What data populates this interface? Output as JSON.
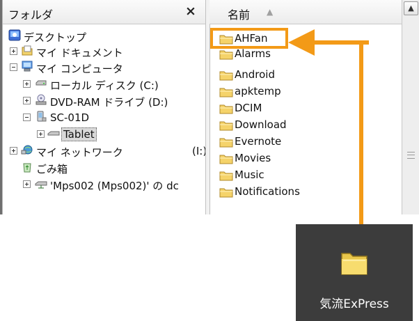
{
  "folder_pane": {
    "title": "フォルダ",
    "close_glyph": "×",
    "tree": [
      {
        "label": "デスクトップ",
        "icon": "desktop-icon"
      },
      {
        "label": "マイ ドキュメント",
        "icon": "my-documents-icon"
      },
      {
        "label": "マイ コンピュータ",
        "icon": "my-computer-icon"
      },
      {
        "label": "ローカル ディスク (C:)",
        "icon": "local-disk-icon"
      },
      {
        "label": "DVD-RAM ドライブ (D:)",
        "icon": "dvd-drive-icon"
      },
      {
        "label": "SC-01D",
        "icon": "phone-icon"
      },
      {
        "label": "Tablet",
        "icon": "tablet-drive-icon"
      },
      {
        "label": "マイ ネットワーク",
        "icon": "network-icon",
        "suffix": "(I:)"
      },
      {
        "label": "ごみ箱",
        "icon": "recycle-bin-icon"
      },
      {
        "label": "'Mps002 (Mps002)' の dc",
        "icon": "network-share-icon"
      }
    ]
  },
  "list_pane": {
    "column_name": "名前",
    "sort_glyph": "▲",
    "files": [
      "AHFan",
      "Alarms",
      "Android",
      "apktemp",
      "DCIM",
      "Download",
      "Evernote",
      "Movies",
      "Music",
      "Notifications"
    ]
  },
  "desktop_shortcut": {
    "label": "気流ExPress"
  },
  "colors": {
    "accent": "#f39a17",
    "tile": "#3c3c3c"
  }
}
